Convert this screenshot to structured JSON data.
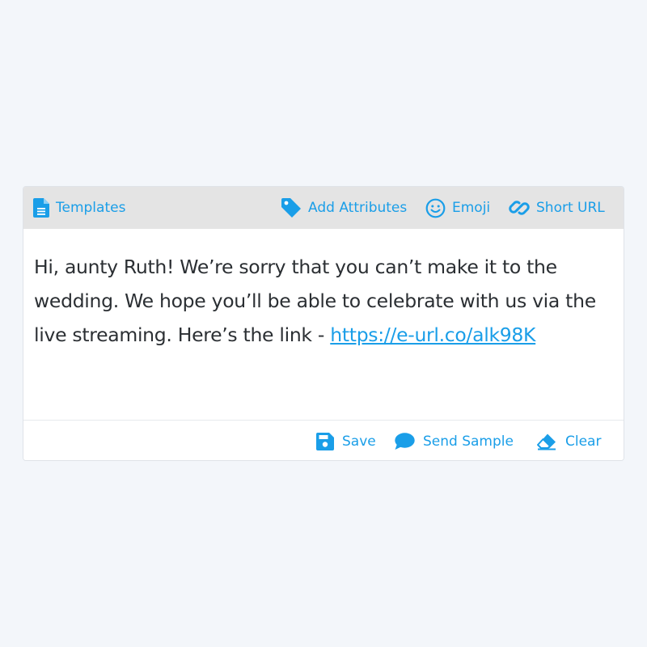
{
  "toolbar": {
    "templates_label": "Templates",
    "add_attributes_label": "Add Attributes",
    "emoji_label": "Emoji",
    "short_url_label": "Short URL"
  },
  "message": {
    "text_before_link": "Hi, aunty Ruth! We’re sorry that you can’t make it to the wedding. We hope you’ll be able to celebrate with us via the live streaming. Here’s the link - ",
    "link": "https://e-url.co/alk98K"
  },
  "actions": {
    "save_label": "Save",
    "send_sample_label": "Send Sample",
    "clear_label": "Clear"
  },
  "icons": {
    "templates": "document-icon",
    "add_attributes": "tag-icon",
    "emoji": "smiley-icon",
    "short_url": "link-icon",
    "save": "floppy-disk-icon",
    "send_sample": "chat-bubble-icon",
    "clear": "eraser-icon"
  },
  "colors": {
    "accent": "#1a9ee8",
    "toolbar_bg": "#e4e4e4",
    "page_bg": "#f3f6fa",
    "text": "#2b2f33"
  }
}
